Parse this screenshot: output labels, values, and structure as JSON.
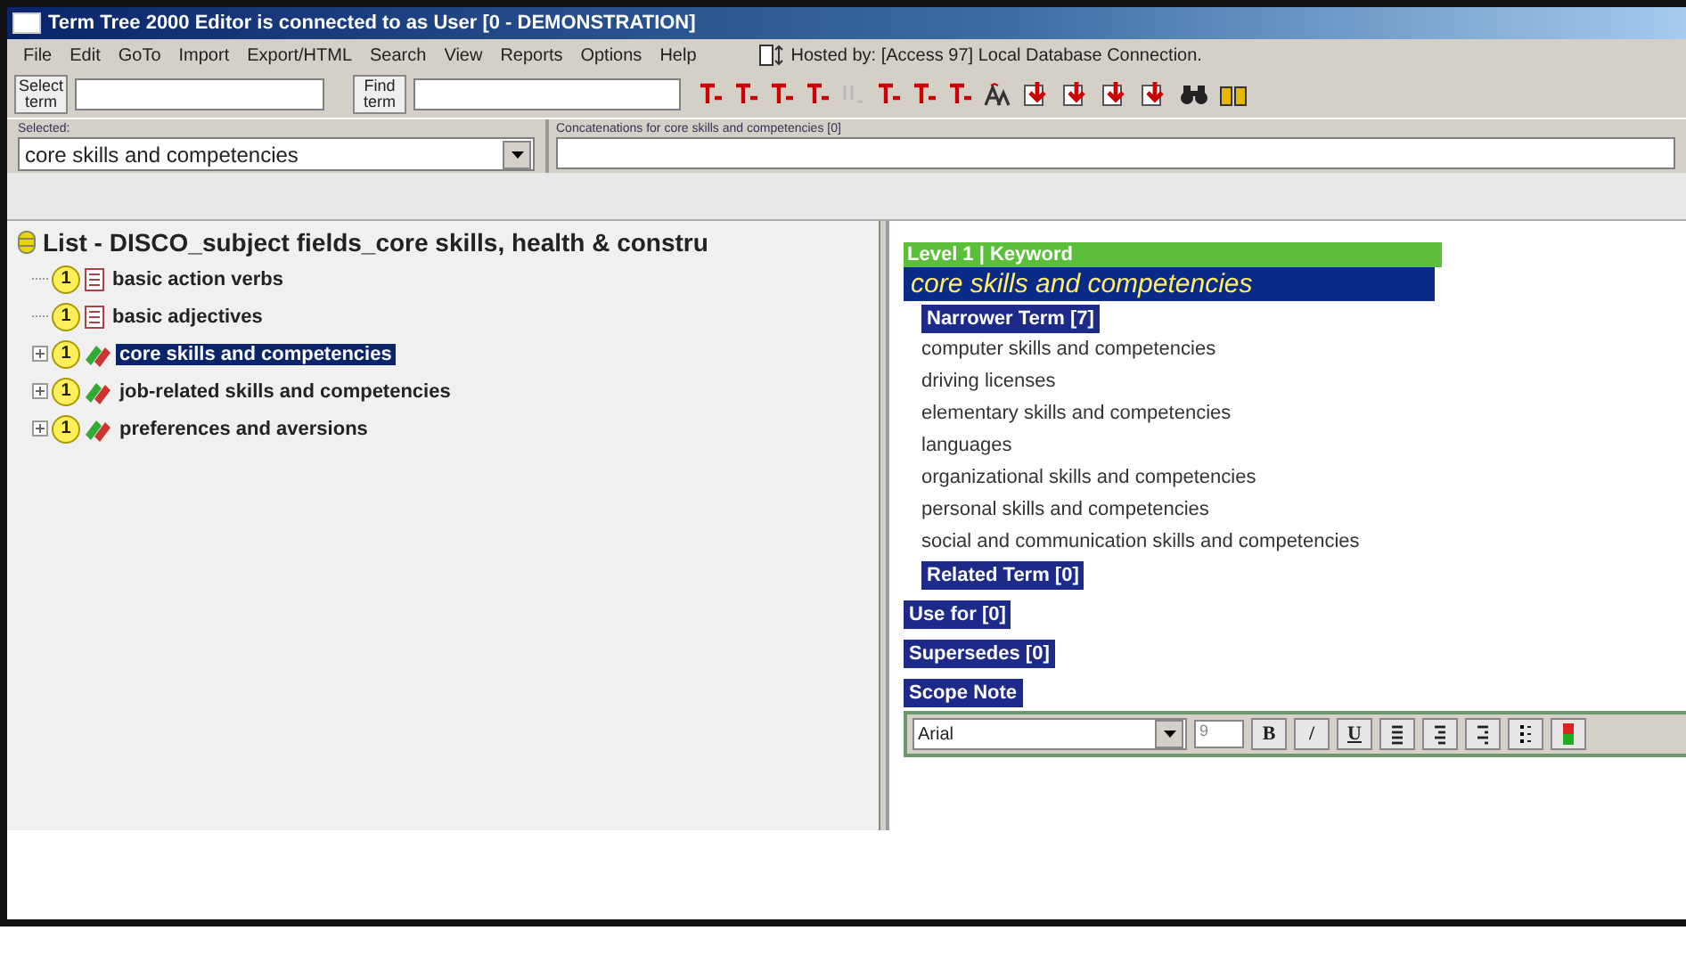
{
  "window": {
    "title": "Term Tree 2000 Editor is connected to  as User [0 - DEMONSTRATION]"
  },
  "menu": [
    "File",
    "Edit",
    "GoTo",
    "Import",
    "Export/HTML",
    "Search",
    "View",
    "Reports",
    "Options",
    "Help"
  ],
  "hosted": {
    "text": "Hosted by:  [Access 97] Local Database Connection."
  },
  "toolbar": {
    "select_label": "Select term",
    "find_label": "Find term",
    "tools": [
      {
        "kind": "tee"
      },
      {
        "kind": "tee"
      },
      {
        "kind": "tee"
      },
      {
        "kind": "tee"
      },
      {
        "kind": "tee-faint"
      },
      {
        "kind": "tee"
      },
      {
        "kind": "tee"
      },
      {
        "kind": "tee"
      },
      {
        "kind": "font"
      },
      {
        "kind": "arrows"
      },
      {
        "kind": "arrows"
      },
      {
        "kind": "arrows"
      },
      {
        "kind": "arrows"
      },
      {
        "kind": "binoculars"
      },
      {
        "kind": "book"
      }
    ]
  },
  "selected": {
    "label": "Selected:",
    "value": "core skills and competencies"
  },
  "concat": {
    "label": "Concatenations for core skills and competencies [0]"
  },
  "tree": {
    "root": "List - DISCO_subject fields_core skills, health & constru",
    "items": [
      {
        "label": "basic action verbs",
        "badge": "1",
        "kind": "leaf",
        "selected": false
      },
      {
        "label": "basic adjectives",
        "badge": "1",
        "kind": "leaf",
        "selected": false
      },
      {
        "label": "core skills and competencies",
        "badge": "1",
        "kind": "branch",
        "selected": true
      },
      {
        "label": "job-related skills and competencies",
        "badge": "1",
        "kind": "branch",
        "selected": false
      },
      {
        "label": "preferences and aversions",
        "badge": "1",
        "kind": "branch",
        "selected": false
      }
    ]
  },
  "detail": {
    "level": "Level 1 | Keyword",
    "term": "core skills and competencies",
    "sections": [
      {
        "title": "Narrower Term [7]",
        "items": [
          "computer skills and competencies",
          "driving licenses",
          "elementary skills and competencies",
          "languages",
          "organizational skills and competencies",
          "personal skills and competencies",
          "social and communication skills and competencies"
        ]
      },
      {
        "title": "Related Term [0]"
      },
      {
        "title": "Use for [0]"
      },
      {
        "title": "Supersedes [0]"
      },
      {
        "title": "Scope Note"
      }
    ],
    "editor": {
      "font": "Arial",
      "size": "9",
      "format": [
        "B",
        "/",
        "U"
      ],
      "tools": [
        {
          "kind": "align-left"
        },
        {
          "kind": "align-center"
        },
        {
          "kind": "align-right"
        },
        {
          "kind": "list"
        },
        {
          "kind": "color"
        }
      ]
    }
  }
}
